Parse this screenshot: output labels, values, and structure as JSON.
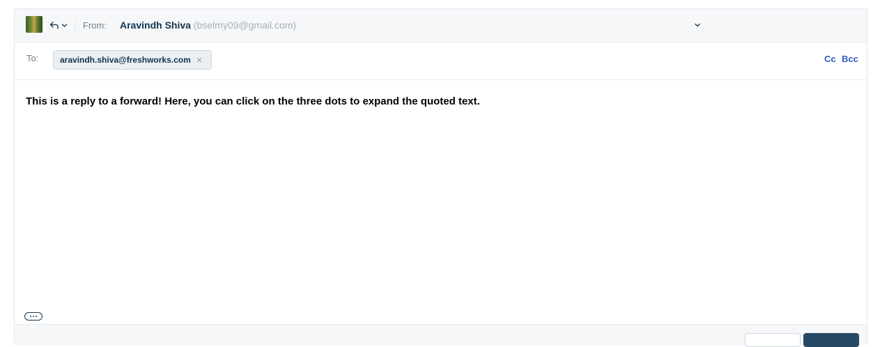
{
  "composer": {
    "reply_mode_icon": "reply-icon",
    "from": {
      "label": "From:",
      "name": "Aravindh Shiva",
      "email": "(bselmy09@gmail.com)"
    },
    "to": {
      "label": "To:",
      "recipients": [
        "aravindh.shiva@freshworks.com"
      ],
      "remove_symbol": "×"
    },
    "cc_label": "Cc",
    "bcc_label": "Bcc",
    "body": "This is a reply to a forward! Here, you can click on the three dots to expand the quoted text."
  },
  "colors": {
    "link": "#2c5cc5",
    "text": "#12344d",
    "header_bg": "#f5f7f9",
    "chip_bg": "#ebeff3",
    "primary_button": "#264966"
  }
}
